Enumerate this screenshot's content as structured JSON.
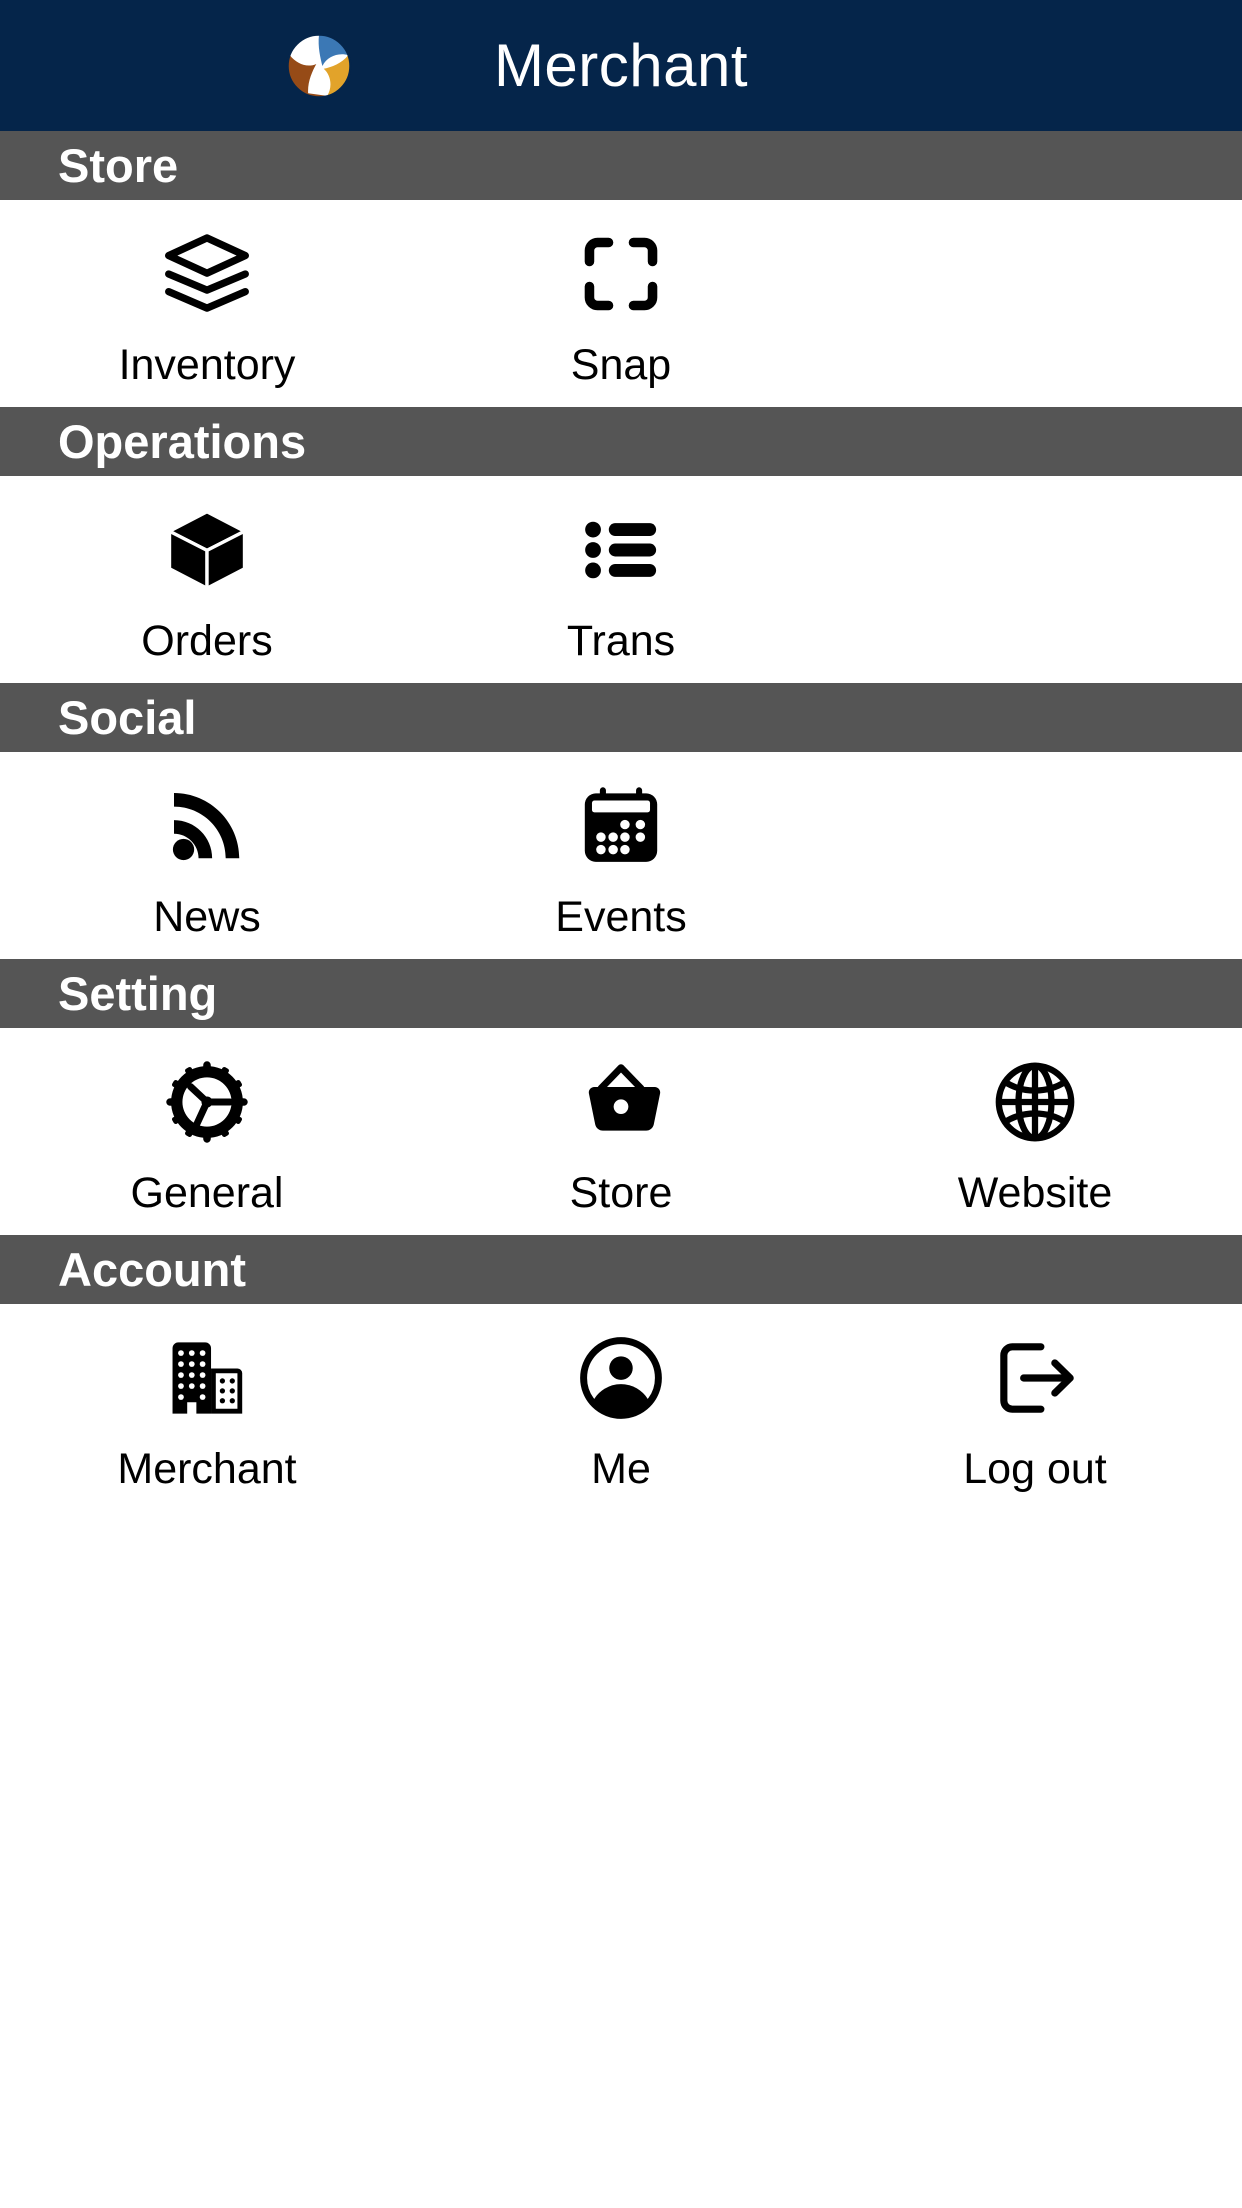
{
  "appbar": {
    "title": "Merchant",
    "logo_name": "brand-triskelion-logo",
    "background_color": "#05254a",
    "title_color": "#ffffff",
    "logo_colors": {
      "blue": "#3b78b5",
      "gold": "#e2a32a",
      "brown": "#964b17",
      "white": "#ffffff"
    }
  },
  "theme": {
    "section_header_bg": "#555555",
    "section_header_text": "#ffffff",
    "tile_bg": "#ffffff",
    "tile_icon_color": "#000000",
    "tile_label_color": "#000000"
  },
  "sections": [
    {
      "title": "Store",
      "items": [
        {
          "label": "Inventory",
          "icon": "layers-stack-icon"
        },
        {
          "label": "Snap",
          "icon": "scan-frame-icon"
        }
      ]
    },
    {
      "title": "Operations",
      "items": [
        {
          "label": "Orders",
          "icon": "cube-box-icon"
        },
        {
          "label": "Trans",
          "icon": "bulleted-list-icon"
        }
      ]
    },
    {
      "title": "Social",
      "items": [
        {
          "label": "News",
          "icon": "rss-feed-icon"
        },
        {
          "label": "Events",
          "icon": "calendar-icon"
        }
      ]
    },
    {
      "title": "Setting",
      "items": [
        {
          "label": "General",
          "icon": "gear-icon"
        },
        {
          "label": "Store",
          "icon": "shopping-basket-icon"
        },
        {
          "label": "Website",
          "icon": "globe-icon"
        }
      ]
    },
    {
      "title": "Account",
      "items": [
        {
          "label": "Merchant",
          "icon": "office-building-icon"
        },
        {
          "label": "Me",
          "icon": "account-circle-icon"
        },
        {
          "label": "Log out",
          "icon": "logout-arrow-icon"
        }
      ]
    }
  ]
}
